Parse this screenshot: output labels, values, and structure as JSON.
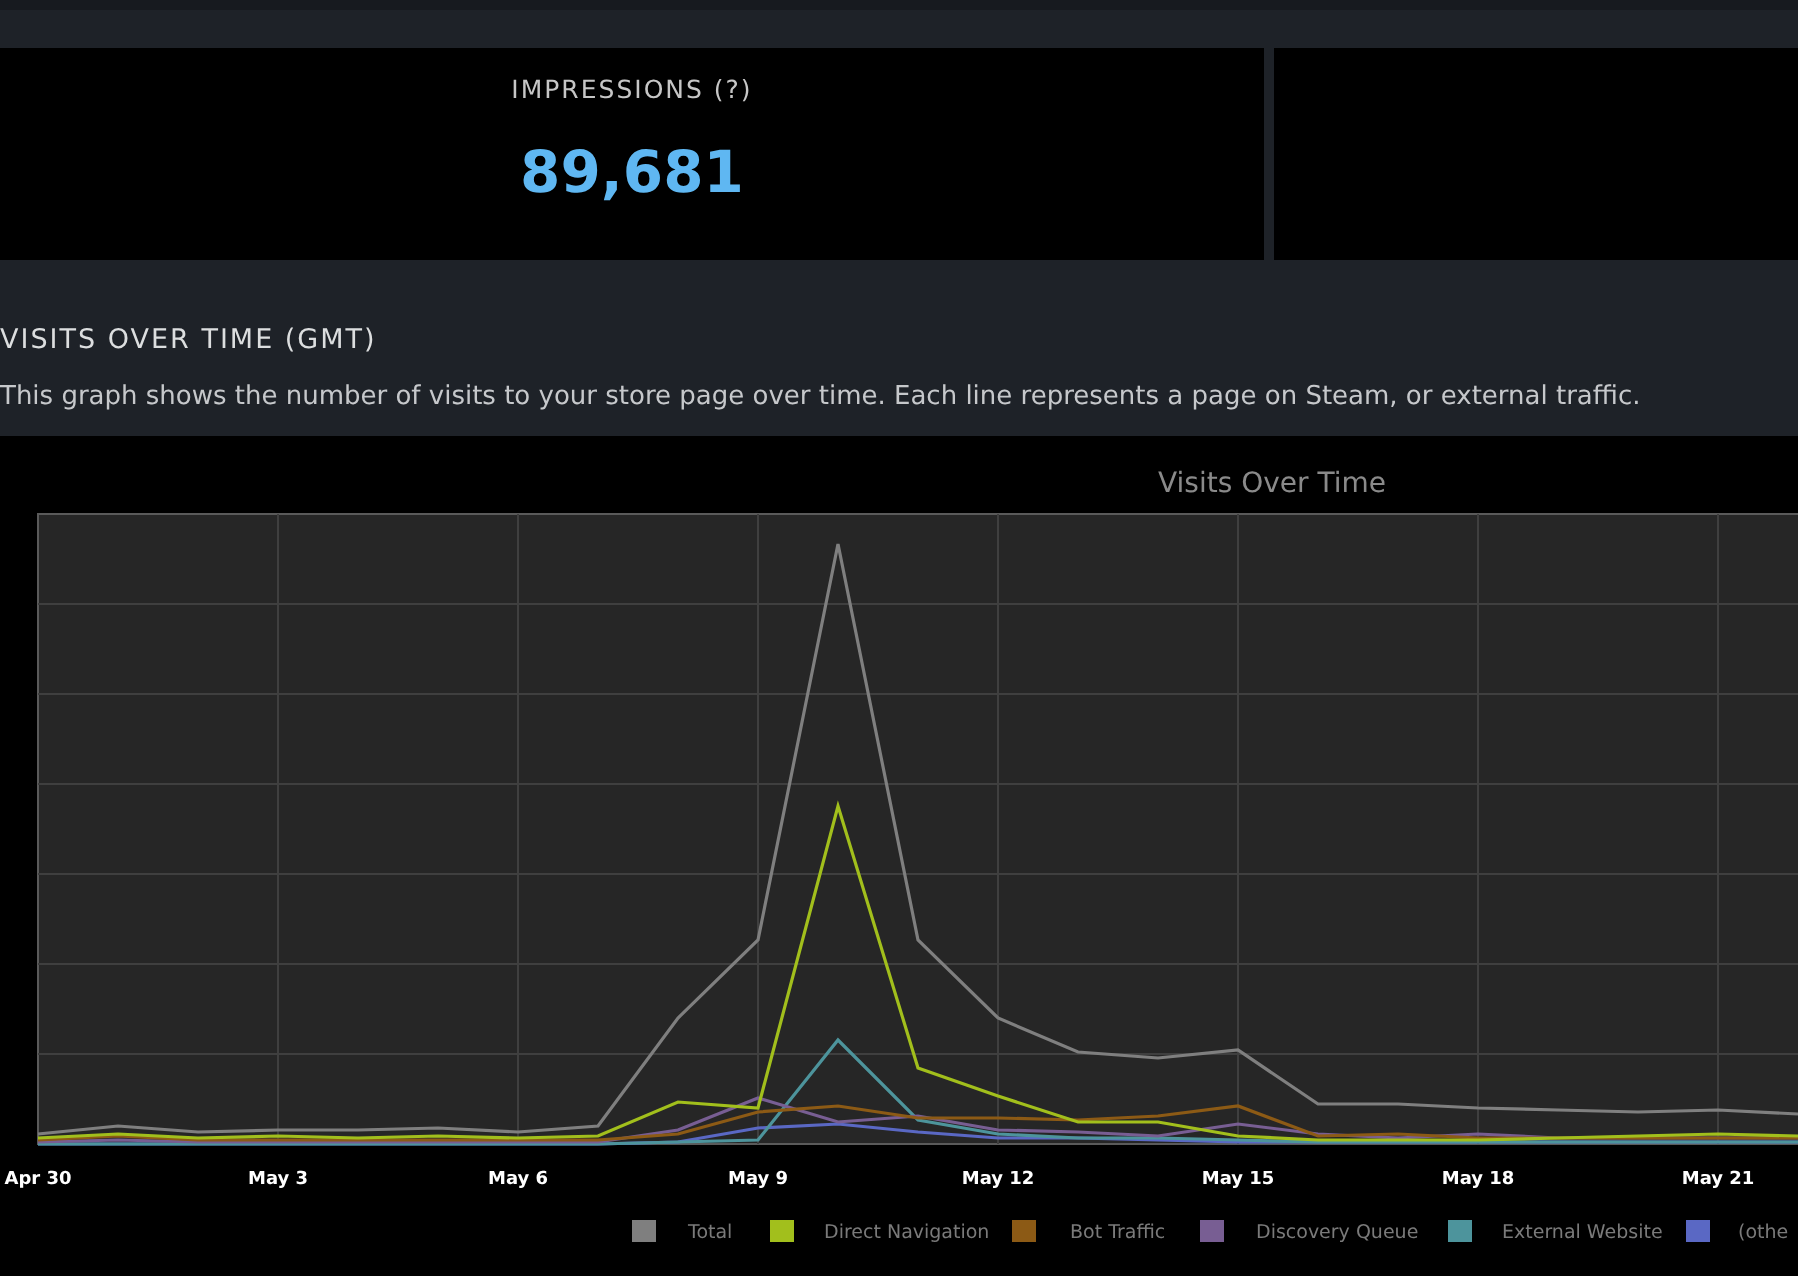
{
  "impressions": {
    "label": "IMPRESSIONS (?)",
    "value": "89,681"
  },
  "visits_section": {
    "title": "VISITS OVER TIME (GMT)",
    "description": "This graph shows the number of visits to your store page over time. Each line represents a page on Steam, or external traffic."
  },
  "visits_chart": {
    "title": "Visits Over Time",
    "x_labels": [
      "Apr 30",
      "May 3",
      "May 6",
      "May 9",
      "May 12",
      "May 15",
      "May 18",
      "May 21"
    ],
    "legend": [
      {
        "label": "Total",
        "color": "#7f7f7f"
      },
      {
        "label": "Direct Navigation",
        "color": "#a2bf1c"
      },
      {
        "label": "Bot Traffic",
        "color": "#8c5a15"
      },
      {
        "label": "Discovery Queue",
        "color": "#785e93"
      },
      {
        "label": "External Website",
        "color": "#4d949c"
      },
      {
        "label": "(othe",
        "color": "#5a68c4"
      }
    ]
  }
}
